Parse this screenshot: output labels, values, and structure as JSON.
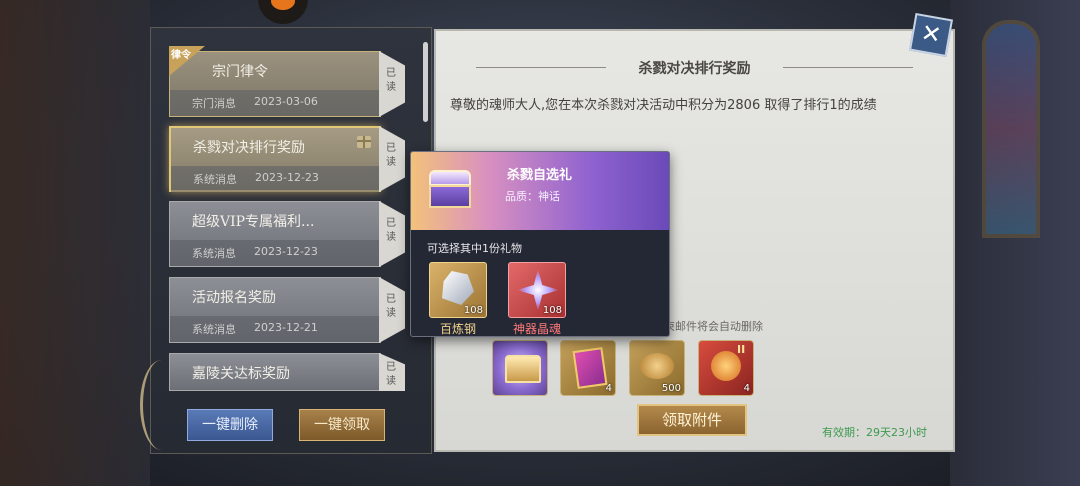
{
  "mail_list": {
    "items": [
      {
        "title": "宗门律令",
        "source": "宗门消息",
        "date": "2023-03-06",
        "read_label": "已读",
        "badge": "律令"
      },
      {
        "title": "杀戮对决排行奖励",
        "source": "系统消息",
        "date": "2023-12-23",
        "read_label": "已读"
      },
      {
        "title": "超级VIP专属福利...",
        "source": "系统消息",
        "date": "2023-12-23",
        "read_label": "已读"
      },
      {
        "title": "活动报名奖励",
        "source": "系统消息",
        "date": "2023-12-21",
        "read_label": "已读"
      },
      {
        "title": "嘉陵关达标奖励",
        "read_label": "已读"
      }
    ],
    "delete_all_label": "一键删除",
    "claim_all_label": "一键领取"
  },
  "detail": {
    "title": "杀戮对决排行奖励",
    "body": "尊敬的魂师大人,您在本次杀戮对决活动中积分为2806  取得了排行1的成绩",
    "hint": "束邮件将会自动删除",
    "attachments": [
      {
        "icon": "chest-icon",
        "count": ""
      },
      {
        "icon": "card-icon",
        "count": "4"
      },
      {
        "icon": "gold-ingot-icon",
        "count": "500"
      },
      {
        "icon": "orb-icon",
        "count": "4",
        "tag": "II"
      }
    ],
    "claim_button": "领取附件",
    "expiry": "有效期：29天23小时"
  },
  "popup": {
    "name": "杀戮自选礼",
    "quality": "品质：神话",
    "desc": "可选择其中1份礼物",
    "rewards": [
      {
        "name": "百炼钢",
        "count": "108",
        "color": "#f0d48e"
      },
      {
        "name": "神器晶魂",
        "count": "108",
        "color": "#ff7a7a"
      }
    ]
  },
  "colors": {
    "accent_gold": "#e3c778",
    "expiry_green": "#3e9a4e"
  }
}
